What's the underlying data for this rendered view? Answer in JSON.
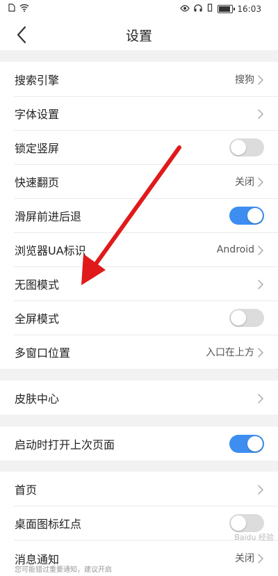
{
  "status_bar": {
    "time": "16:03"
  },
  "header": {
    "title": "设置"
  },
  "groups": [
    {
      "rows": [
        {
          "label": "搜索引擎",
          "value": "搜狗",
          "kind": "chevron"
        },
        {
          "label": "字体设置",
          "value": "",
          "kind": "chevron"
        },
        {
          "label": "锁定竖屏",
          "kind": "toggle",
          "on": false
        },
        {
          "label": "快速翻页",
          "value": "关闭",
          "kind": "chevron"
        },
        {
          "label": "滑屏前进后退",
          "kind": "toggle",
          "on": true
        },
        {
          "label": "浏览器UA标识",
          "value": "Android",
          "kind": "chevron"
        },
        {
          "label": "无图模式",
          "value": "",
          "kind": "chevron"
        },
        {
          "label": "全屏模式",
          "kind": "toggle",
          "on": false
        },
        {
          "label": "多窗口位置",
          "value": "入口在上方",
          "kind": "chevron"
        }
      ]
    },
    {
      "rows": [
        {
          "label": "皮肤中心",
          "value": "",
          "kind": "chevron"
        }
      ]
    },
    {
      "rows": [
        {
          "label": "启动时打开上次页面",
          "kind": "toggle",
          "on": true
        }
      ]
    },
    {
      "rows": [
        {
          "label": "首页",
          "value": "",
          "kind": "chevron"
        },
        {
          "label": "桌面图标红点",
          "kind": "toggle",
          "on": false
        },
        {
          "label": "消息通知",
          "sub": "您可能错过重要通知，建议开启",
          "value": "关闭",
          "kind": "chevron"
        }
      ]
    }
  ],
  "colors": {
    "toggle_on": "#3d8ef0",
    "arrow": "#e0191b"
  },
  "watermark": "Baidu 经验"
}
